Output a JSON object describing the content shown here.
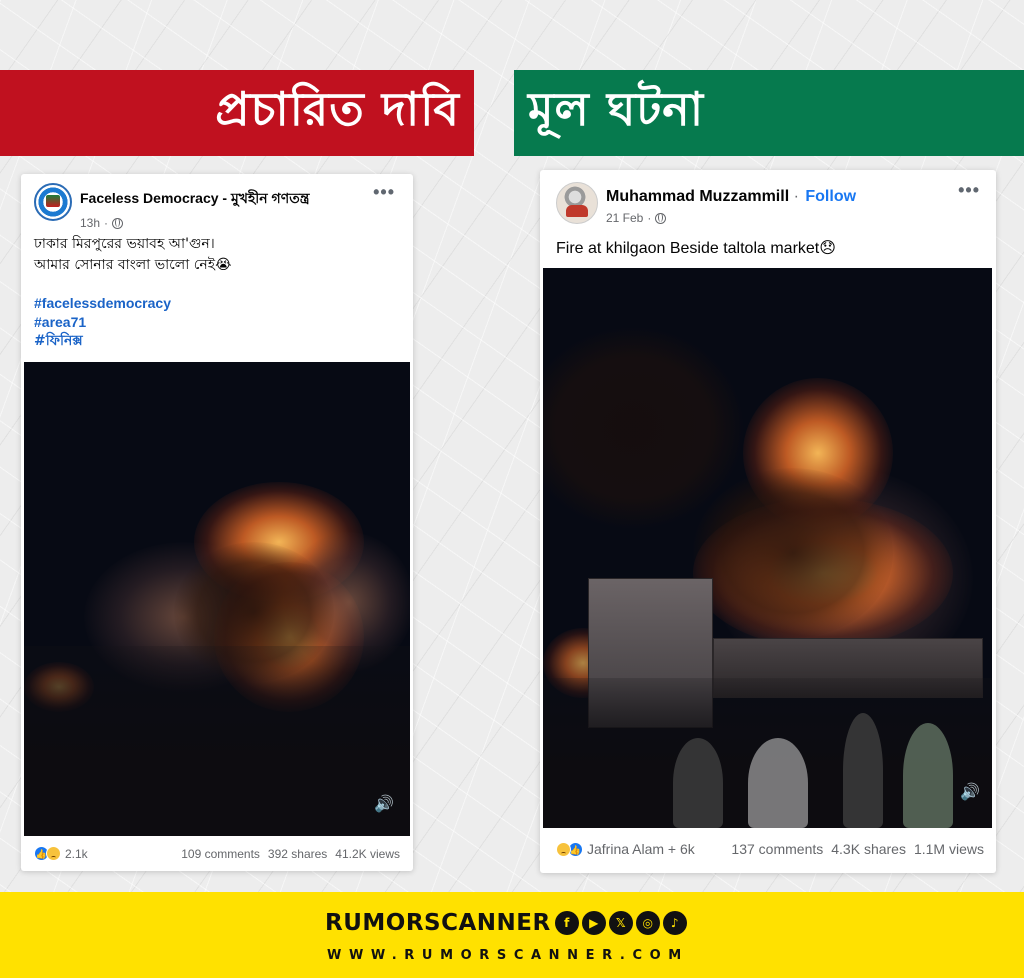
{
  "banners": {
    "claimed": "প্রচারিত দাবি",
    "actual": "মূল ঘটনা",
    "claimed_color": "#c0111f",
    "actual_color": "#067a4e"
  },
  "left_post": {
    "page_name": "Faceless Democracy - মুখহীন গণতন্ত্র",
    "time": "13h",
    "text_line1": "ঢাকার মিরপুরের ভয়াবহ আ'গুন।",
    "text_line2": "আমার সোনার বাংলা ভালো নেই😭",
    "hashtags": [
      "#facelessdemocracy",
      "#area71",
      "#ফিনিক্স"
    ],
    "reaction_count": "2.1k",
    "comments": "109 comments",
    "shares": "392 shares",
    "views": "41.2K views",
    "avatar_icon": "faceless-democracy-logo-icon",
    "privacy_icon": "globe-icon",
    "more_icon": "more-options-icon",
    "speaker_icon": "speaker-icon"
  },
  "right_post": {
    "user_name": "Muhammad Muzzammill",
    "follow": "Follow",
    "separator": "·",
    "time": "21 Feb",
    "text": "Fire at khilgaon Beside taltola market😞",
    "reaction_names": "Jafrina Alam + 6k",
    "comments": "137 comments",
    "shares": "4.3K shares",
    "views": "1.1M views",
    "privacy_icon": "globe-icon",
    "more_icon": "more-options-icon",
    "speaker_icon": "speaker-icon"
  },
  "footer": {
    "brand": "RUMORSCANNER",
    "website": "WWW.RUMORSCANNER.COM",
    "social_icons": [
      "facebook-icon",
      "youtube-icon",
      "x-icon",
      "instagram-icon",
      "tiktok-icon"
    ],
    "social_glyphs": [
      "f",
      "▶",
      "𝕏",
      "◎",
      "♪"
    ],
    "background": "#ffe100"
  }
}
